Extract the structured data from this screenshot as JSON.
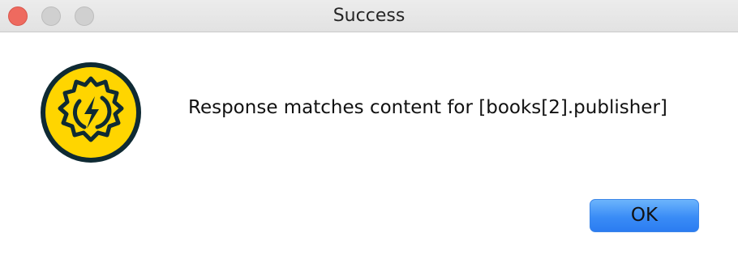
{
  "window": {
    "title": "Success"
  },
  "dialog": {
    "icon": "yellow-gear-lightning-icon",
    "message": "Response matches content for [books[2].publisher]",
    "ok_label": "OK"
  },
  "colors": {
    "close": "#ee6a5f",
    "inactive_control": "#d0d0d0",
    "icon_fill": "#ffd500",
    "icon_outline": "#0f2a33",
    "button_accent": "#3a8cf6"
  }
}
